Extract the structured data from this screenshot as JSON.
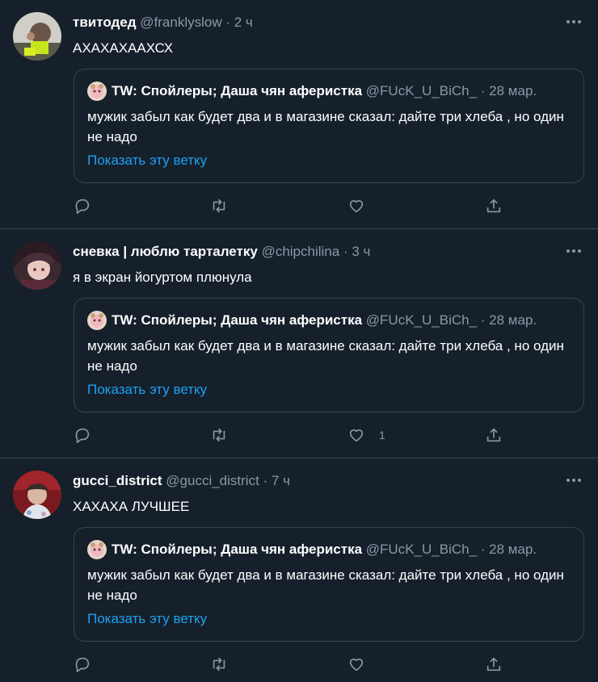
{
  "quoted": {
    "display_name": "TW: Спойлеры; Даша чян аферистка",
    "handle": "@FUcK_U_BiCh_",
    "time": "28 мар.",
    "text": "мужик забыл как будет два и в магазине сказал: дайте три хлеба , но один не надо",
    "show_thread": "Показать эту ветку"
  },
  "tweets": [
    {
      "display_name": "твитодед",
      "handle": "@franklyslow",
      "time": "2 ч",
      "text": "АХАХАХААХСХ",
      "like_count": ""
    },
    {
      "display_name": "сневка | люблю тарталетку",
      "handle": "@chipchilina",
      "time": "3 ч",
      "text": "я в экран йогуртом плюнула",
      "like_count": "1"
    },
    {
      "display_name": "gucci_district",
      "handle": "@gucci_district",
      "time": "7 ч",
      "text": "ХАХАХА ЛУЧШЕЕ",
      "like_count": ""
    }
  ],
  "icons": {
    "more": "more-dots-icon",
    "reply": "reply-icon",
    "retweet": "retweet-icon",
    "like": "heart-icon",
    "share": "share-icon"
  },
  "colors": {
    "background": "#15202b",
    "border": "#38444d",
    "secondary_text": "#8899a6",
    "link": "#1da1f2"
  }
}
